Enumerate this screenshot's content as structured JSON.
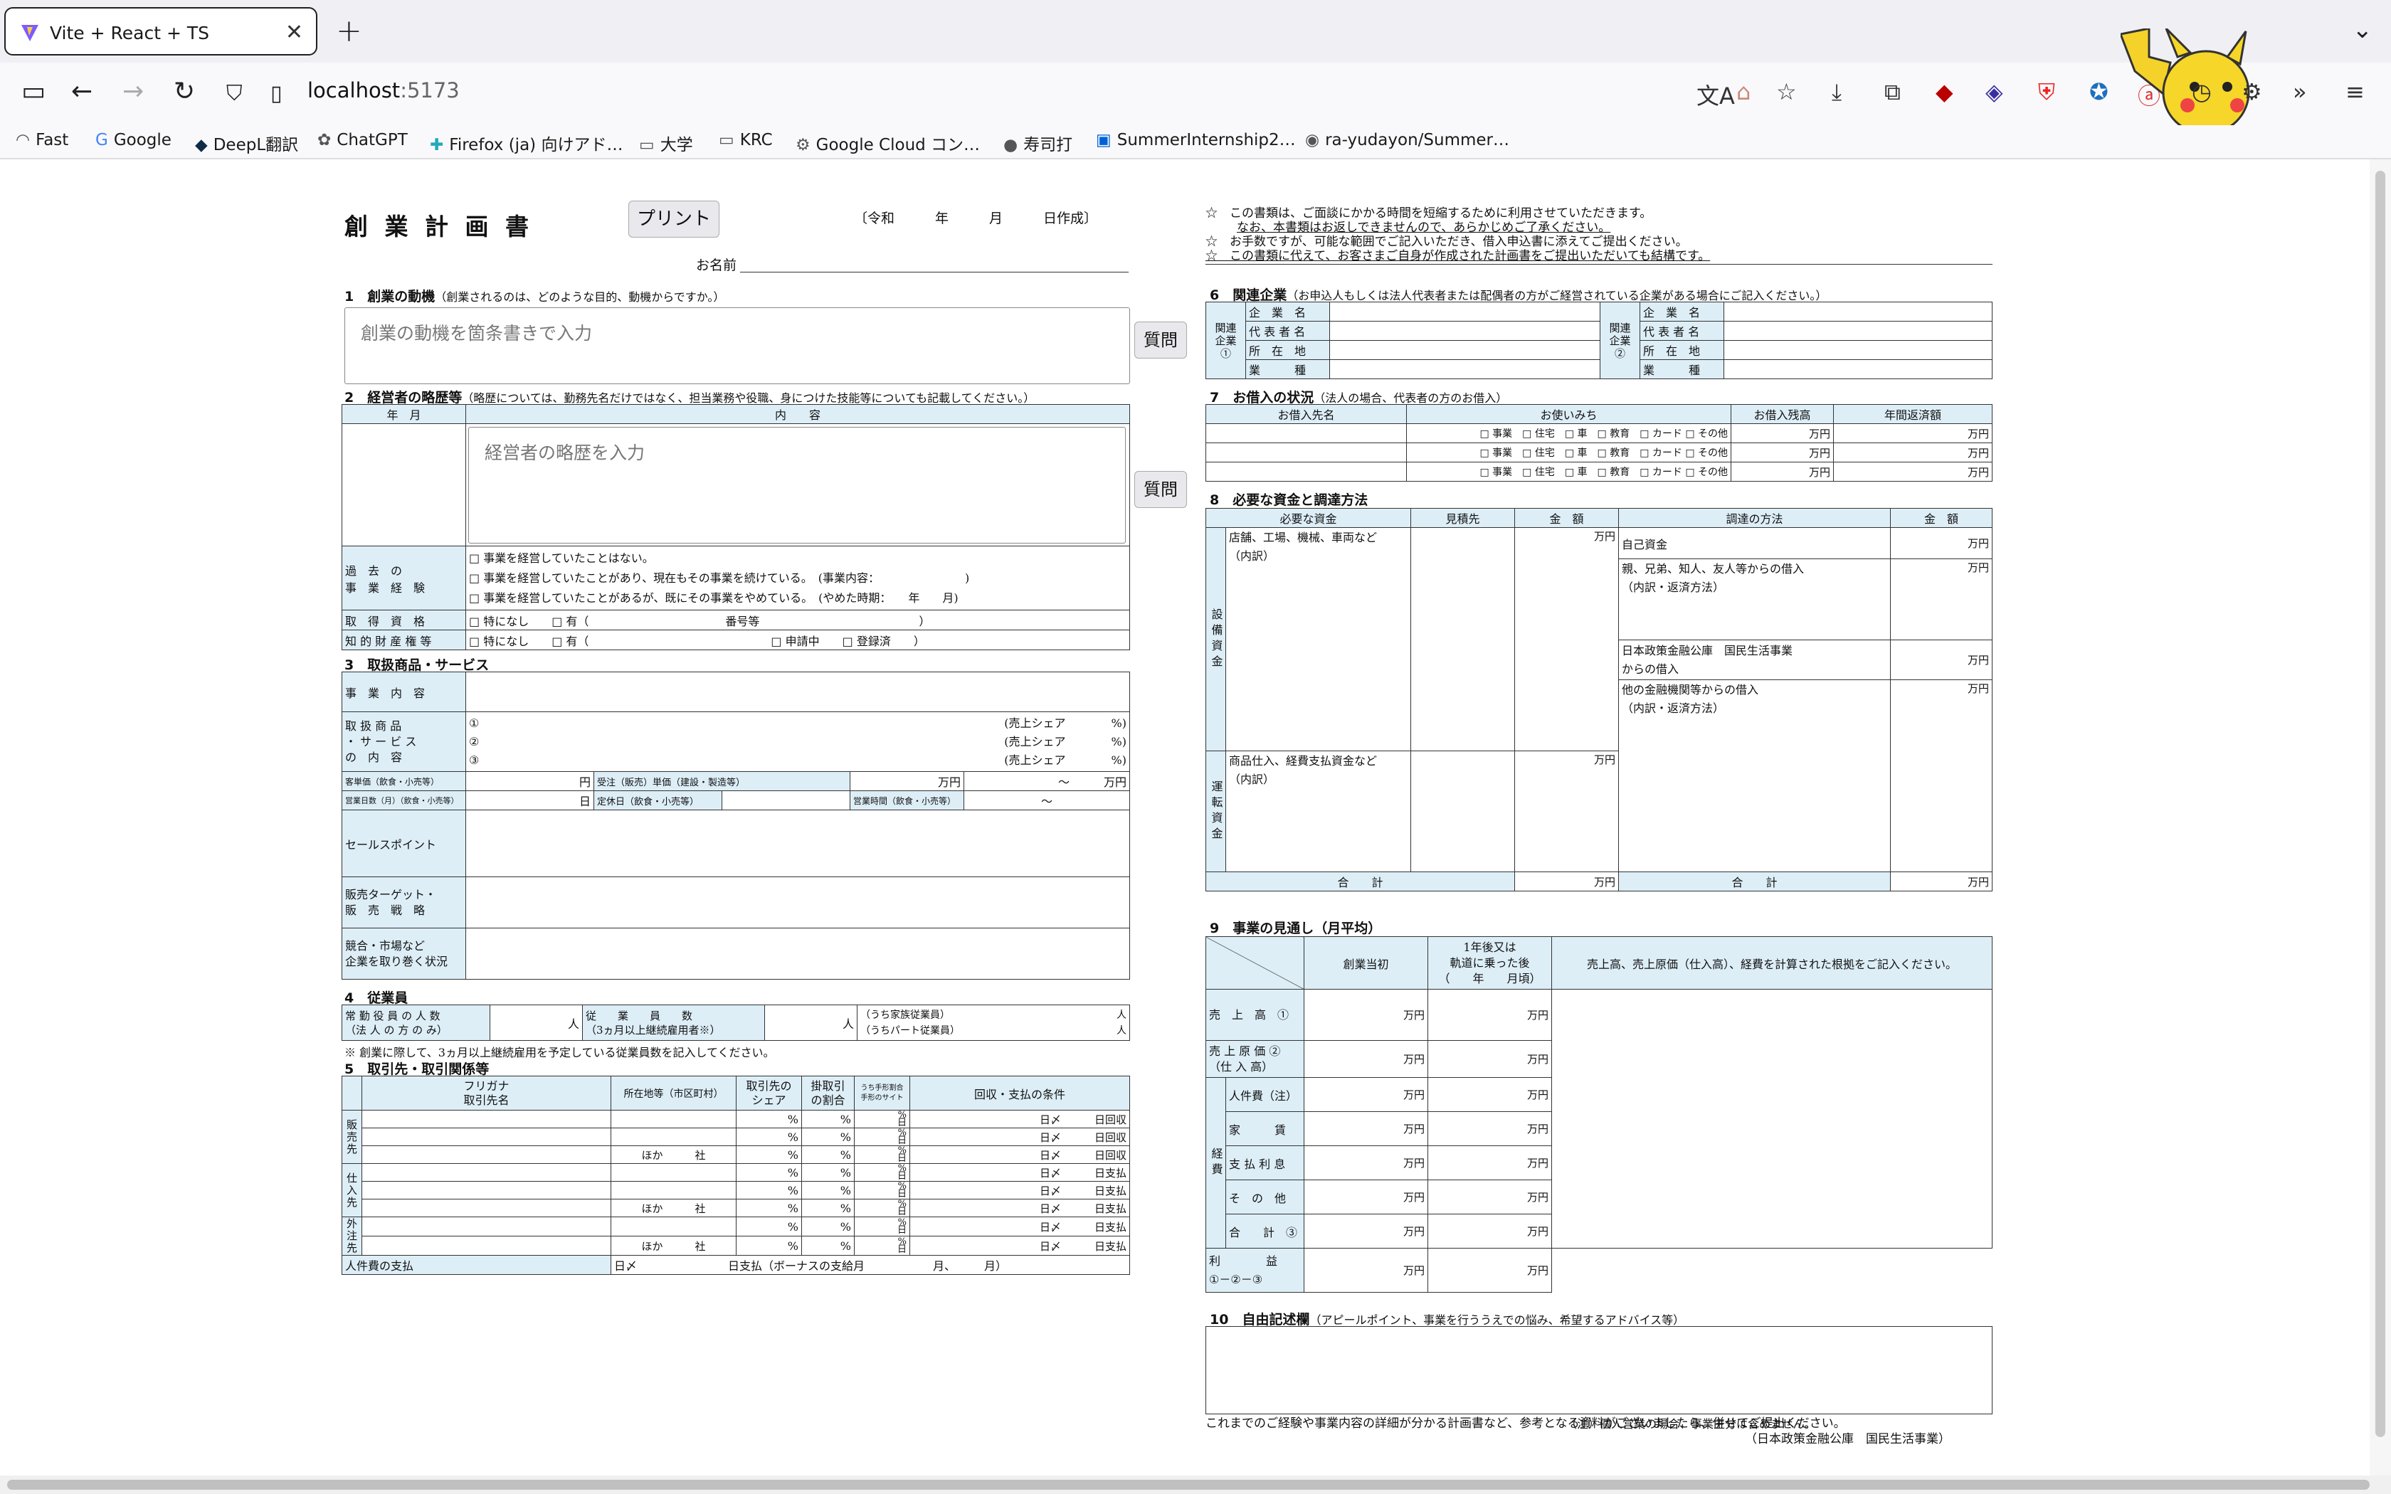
{
  "browser": {
    "tab_title": "Vite + React + TS",
    "url_host": "localhost",
    "url_port": ":5173",
    "bookmarks": [
      "Fast",
      "Google",
      "DeepL翻訳",
      "ChatGPT",
      "Firefox (ja) 向けアド…",
      "大学",
      "KRC",
      "Google Cloud コン…",
      "寿司打",
      "SummerInternship2…",
      "ra-yudayon/Summer…"
    ]
  },
  "header": {
    "title": "創 業 計 画 書",
    "print_label": "プリント",
    "date": "〔令和　　　年　　　月　　　日作成〕",
    "name_label": "お名前",
    "notes": [
      "☆　この書類は、ご面談にかかる時間を短縮するために利用させていただきます。",
      "なお、本書類はお返しできませんので、あらかじめご了承ください。",
      "☆　お手数ですが、可能な範囲でご記入いただき、借入申込書に添えてご提出ください。",
      "☆　この書類に代えて、お客さまご自身が作成された計画書をご提出いただいても結構です。"
    ]
  },
  "s1": {
    "title": "1　創業の動機",
    "sub": "（創業されるのは、どのような目的、動機からですか。）",
    "placeholder": "創業の動機を箇条書きで入力",
    "ask": "質問"
  },
  "s2": {
    "title": "2　経営者の略歴等",
    "sub": "（略歴については、勤務先名だけではなく、担当業務や役職、身につけた技能等についても記載してください。）",
    "col_date": "年　月",
    "col_content": "内　　容",
    "placeholder": "経営者の略歴を入力",
    "ask": "質問",
    "exp_label": "過　去　の\n事　業　経　験",
    "exp1": "□ 事業を経営していたことはない。",
    "exp2": "□ 事業を経営していたことがあり、現在もその事業を続けている。　(事業内容：　　　　　　　　)",
    "exp3": "□ 事業を経営していたことがあるが、既にその事業をやめている。　(やめた時期：　　年　　月)",
    "qual_label": "取　得　資　格",
    "qual": "□ 特になし　　□ 有（　　　　　　　　　　　　番号等　　　　　　　　　　　　　　）",
    "ip_label": "知 的 財 産 権 等",
    "ip": "□ 特になし　　□ 有（　　　　　　　　　　　　　　　　□ 申請中　　□ 登録済　　）"
  },
  "s3": {
    "title": "3　取扱商品・サービス",
    "biz_label": "事　業　内　容",
    "goods_label": "取 扱 商 品\n・ サ ー ビ ス\nの　内　容",
    "goods": [
      "①",
      "②",
      "③"
    ],
    "share": "(売上シェア　　　　%)",
    "unit_price": "客単価（飲食・小売等）",
    "yen": "円",
    "order_price": "受注（販売）単価（建設・製造等）",
    "manen": "万円",
    "range": "～",
    "seats": "営業日数（月）（飲食・小売等）",
    "day": "日",
    "holiday": "定休日（飲食・小売等）",
    "hours": "営業時間（飲食・小売等）",
    "tilde": "～",
    "sales_point": "セールスポイント",
    "target": "販売ターゲット・\n販　売　戦　略",
    "competition": "競合・市場など\n企業を取り巻く状況"
  },
  "s4": {
    "title": "4　従業員",
    "directors": "常 勤 役 員 の 人 数\n（法 人 の 方 の み）",
    "people": "人",
    "employees": "従　　業　　員　　数\n（3ヵ月以上継続雇用者※）",
    "family": "（うち家族従業員）",
    "part": "（うちパート従業員）",
    "note": "※ 創業に際して、3ヵ月以上継続雇用を予定している従業員数を記入してください。"
  },
  "s5": {
    "title": "5　取引先・取引関係等",
    "furigana": "フリガナ",
    "name": "取引先名",
    "location": "所在地等（市区町村）",
    "share": "取引先の\nシェア",
    "ratio": "掛取引\nの割合",
    "site": "うち手形割合\n手形のサイト",
    "terms": "回収・支払の条件",
    "groups": [
      {
        "label": "販売先",
        "end": "日回収"
      },
      {
        "label": "仕入先",
        "end": "日支払"
      },
      {
        "label": "外注先",
        "end": "日支払"
      }
    ],
    "pct": "%",
    "day": "日",
    "close": "日〆",
    "others": "ほか　　　社",
    "payroll_label": "人件費の支払",
    "payroll": "日〆　　　　　　　　日支払（ボーナスの支給月　　　　　　月、　　　月）"
  },
  "s6": {
    "title": "6　関連企業",
    "sub": "（お申込人もしくは法人代表者または配偶者の方がご経営されている企業がある場合にご記入ください。）",
    "side1": "関連企業①",
    "side2": "関連企業②",
    "rows": [
      "企　業　名",
      "代 表 者 名",
      "所　在　地",
      "業　　　種"
    ]
  },
  "s7": {
    "title": "7　お借入の状況",
    "sub": "（法人の場合、代表者の方のお借入）",
    "cols": [
      "お借入先名",
      "お使いみち",
      "お借入残高",
      "年間返済額"
    ],
    "uses": "□ 事業　□ 住宅　□ 車　□ 教育　□ カード □ その他",
    "manen": "万円"
  },
  "s8": {
    "title": "8　必要な資金と調達方法",
    "cols": [
      "必要な資金",
      "見積先",
      "金　額",
      "調達の方法",
      "金　額"
    ],
    "equip": "設備資金",
    "equip_item": "店舗、工場、機械、車両など\n（内訳）",
    "working": "運転資金",
    "working_item": "商品仕入、経費支払資金など\n（内訳）",
    "sources": [
      "自己資金",
      "親、兄弟、知人、友人等からの借入\n（内訳・返済方法）",
      "日本政策金融公庫　国民生活事業\nからの借入",
      "他の金融機関等からの借入\n（内訳・返済方法）"
    ],
    "total": "合　　計",
    "manen": "万円"
  },
  "s9": {
    "title": "9　事業の見通し（月平均）",
    "col1": "創業当初",
    "col2": "1年後又は\n軌道に乗った後\n（　　年　　月頃）",
    "col3": "売上高、売上原価（仕入高）、経費を計算された根拠をご記入ください。",
    "rows": [
      "売　上　高　①",
      "売 上 原 価 ②\n（仕 入 高）",
      "人件費（注）",
      "家　　　賃",
      "支 払 利 息",
      "そ　の　他",
      "合　　計　③"
    ],
    "expense": "経費",
    "profit": "利　　　　益\n①－②－③",
    "manen": "万円",
    "note": "（注）個人営業の場合、事業主分は含めません。"
  },
  "s10": {
    "title": "10　自由記述欄",
    "sub": "（アピールポイント、事業を行ううえでの悩み、希望するアドバイス等）",
    "footer": "これまでのご経験や事業内容の詳細が分かる計画書など、参考となる資料がございましたら、併せてご提出ください。",
    "org": "（日本政策金融公庫　国民生活事業）"
  }
}
